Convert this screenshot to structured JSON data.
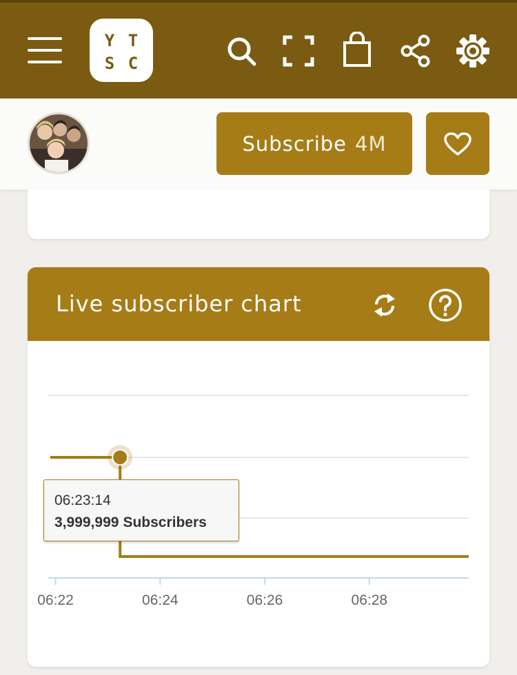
{
  "topbar": {
    "logo_letters": [
      "Y",
      "T",
      "S",
      "C"
    ],
    "icons": [
      "hamburger-menu-icon",
      "search-icon",
      "fullscreen-icon",
      "shopping-bag-icon",
      "share-icon",
      "settings-gear-icon"
    ]
  },
  "subheader": {
    "subscribe_label": "Subscribe",
    "subscribe_count": "4M",
    "favorite_icon": "heart-icon"
  },
  "chart_card": {
    "title": "Live subscriber chart",
    "refresh_icon": "refresh-icon",
    "help_icon": "help-circle-icon",
    "tooltip": {
      "time": "06:23:14",
      "value": "3,999,999",
      "unit": "Subscribers"
    }
  },
  "colors": {
    "topbar": "#7b5b12",
    "accent": "#a67c17",
    "background": "#f1efec",
    "card": "#ffffff"
  },
  "chart_data": {
    "type": "line",
    "title": "Live subscriber chart",
    "xlabel": "",
    "ylabel": "",
    "x_ticks": [
      "06:22",
      "06:24",
      "06:26",
      "06:28"
    ],
    "xlim": [
      "06:21:54",
      "06:29:54"
    ],
    "grid": true,
    "legend": "none",
    "series": [
      {
        "x": [
          "06:21:54",
          "06:23:14",
          "06:23:20",
          "06:29:54"
        ],
        "y": [
          3999999,
          3999999,
          3999998,
          3999998
        ]
      }
    ],
    "highlighted_point": {
      "x": "06:23:14",
      "y": 3999999
    }
  }
}
